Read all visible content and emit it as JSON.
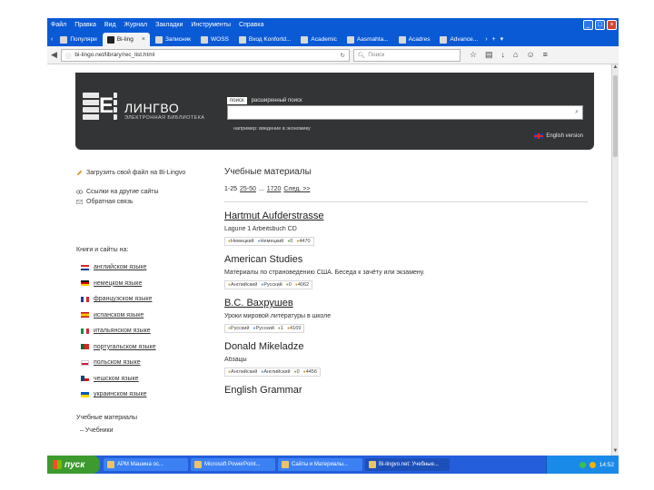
{
  "browser": {
    "menu": [
      "Файл",
      "Правка",
      "Вид",
      "Журнал",
      "Закладки",
      "Инструменты",
      "Справка"
    ],
    "tabs": [
      {
        "label": "Популяри",
        "active": false
      },
      {
        "label": "Bi-ling",
        "active": true
      },
      {
        "label": "Записник",
        "active": false
      },
      {
        "label": "WOSS",
        "active": false
      },
      {
        "label": "Вход Konfortd...",
        "active": false
      },
      {
        "label": "Academic",
        "active": false
      },
      {
        "label": "Aasmahta...",
        "active": false
      },
      {
        "label": "Acadres",
        "active": false
      },
      {
        "label": "Advance...",
        "active": false
      }
    ],
    "url": "bi-lingo.net/library/rec_list.html",
    "search_placeholder": "Поиск"
  },
  "header": {
    "logo_letter": "E",
    "logo_title": "ЛИНГВО",
    "logo_subtitle": "ЭЛЕКТРОННАЯ БИБЛИОТЕКА",
    "search_tabs": [
      "поиск",
      "расширенный поиск"
    ],
    "search_hint": "например: введение в экономику",
    "english_version": "English version"
  },
  "sidebar": {
    "upload": "Загрузить свой файл на Bi-Lingvo",
    "links": [
      "Ссылки на другие сайты",
      "Обратная связь"
    ],
    "section_title": "Книги и сайты на:",
    "languages": [
      {
        "label": "английском языке",
        "flag": "en"
      },
      {
        "label": "немецком языке",
        "flag": "de"
      },
      {
        "label": "французском языке",
        "flag": "fr"
      },
      {
        "label": "испанском языке",
        "flag": "es"
      },
      {
        "label": "итальянском языке",
        "flag": "it"
      },
      {
        "label": "португальском языке",
        "flag": "pt"
      },
      {
        "label": "польском языке",
        "flag": "pl"
      },
      {
        "label": "чешском языке",
        "flag": "cz"
      },
      {
        "label": "украинском языке",
        "flag": "ua"
      }
    ],
    "edu_title": "Учебные материалы",
    "edu_item": "– Учебники"
  },
  "main": {
    "heading": "Учебные материалы",
    "pager": {
      "range": "1-25",
      "next_range": "25-50",
      "sep": "...",
      "end_range": "1720",
      "next": "След. >>"
    },
    "entries": [
      {
        "title": "Hartmut Aufderstrasse",
        "underline": true,
        "desc": "Lagune 1 Arbeitsbuch CD",
        "meta": [
          "Немецкий",
          "Немецкий",
          "0",
          "4470"
        ]
      },
      {
        "title": "American Studies",
        "underline": false,
        "desc": "Материалы по страноведению США. Беседа к зачёту или экзамену.",
        "meta": [
          "Английский",
          "Русский",
          "0",
          "4062"
        ]
      },
      {
        "title": "В.С. Вахрушев",
        "underline": true,
        "desc": "Уроки мировой литературы в школе",
        "meta": [
          "Русский",
          "Русский",
          "1",
          "4169"
        ]
      },
      {
        "title": "Donald Mikeladze",
        "underline": false,
        "desc": "Абзацы",
        "meta": [
          "Английский",
          "Английский",
          "0",
          "4456"
        ]
      },
      {
        "title": "English Grammar",
        "underline": false,
        "desc": "",
        "meta": []
      }
    ]
  },
  "taskbar": {
    "start": "пуск",
    "items": [
      {
        "label": "АРМ Машина ос...",
        "active": false
      },
      {
        "label": "Microsoft PowerPoint...",
        "active": false
      },
      {
        "label": "Сайты и Материалы...",
        "active": false
      },
      {
        "label": "Bi-lingvo.net: Учебные...",
        "active": true
      }
    ],
    "clock": "14:52"
  }
}
